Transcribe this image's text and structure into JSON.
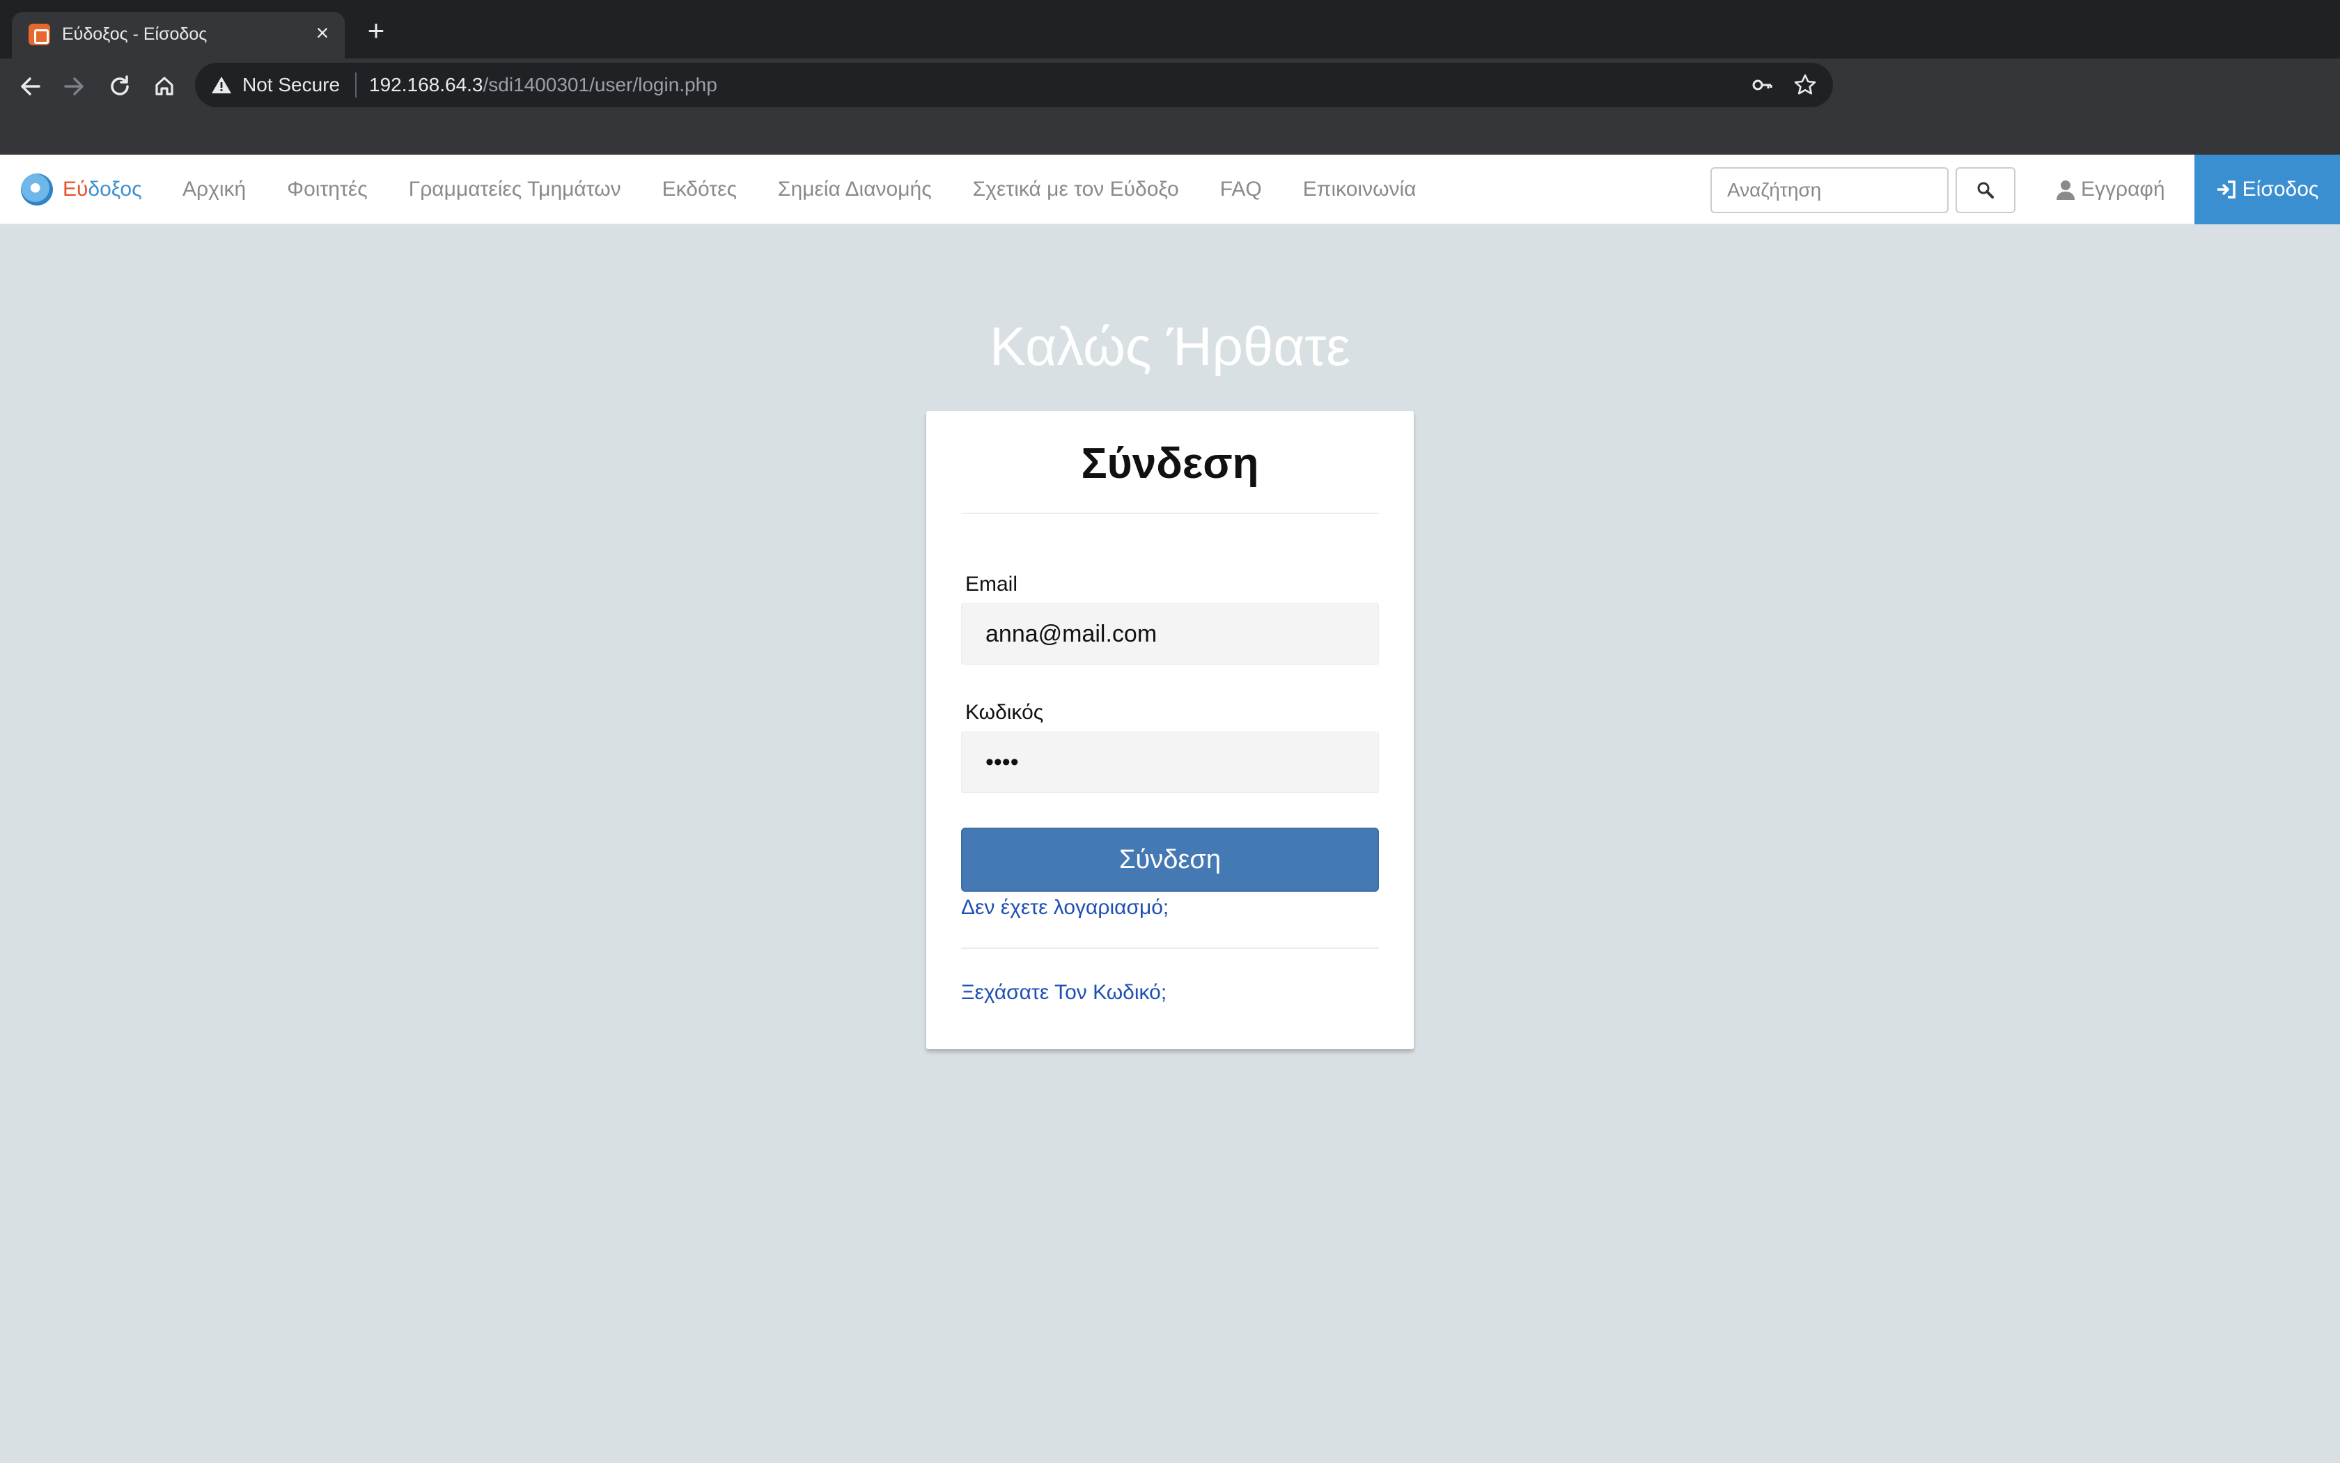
{
  "browser": {
    "tab_title": "Εύδοξος - Είσοδος",
    "security_label": "Not Secure",
    "url_host": "192.168.64.3",
    "url_path": "/sdi1400301/user/login.php"
  },
  "site": {
    "brand_part1": "Εύ",
    "brand_part2": "δοξος",
    "nav": [
      "Αρχική",
      "Φοιτητές",
      "Γραμματείες Τμημάτων",
      "Εκδότες",
      "Σημεία Διανομής",
      "Σχετικά με τον Εύδοξο",
      "FAQ",
      "Επικοινωνία"
    ],
    "search_placeholder": "Αναζήτηση",
    "register_label": "Εγγραφή",
    "login_label": "Είσοδος"
  },
  "main": {
    "welcome": "Καλώς Ήρθατε",
    "card_title": "Σύνδεση",
    "email_label": "Email",
    "email_value": "anna@mail.com",
    "password_label": "Κωδικός",
    "password_value": "••••",
    "submit_label": "Σύνδεση",
    "no_account_link": "Δεν έχετε λογαριασμό;",
    "forgot_link": "Ξεχάσατε Τον Κωδικό;"
  },
  "colors": {
    "background": "#d8e0e4",
    "primary_button": "#4479b3",
    "nav_login": "#3a8fd1",
    "link": "#1f4fb3"
  }
}
